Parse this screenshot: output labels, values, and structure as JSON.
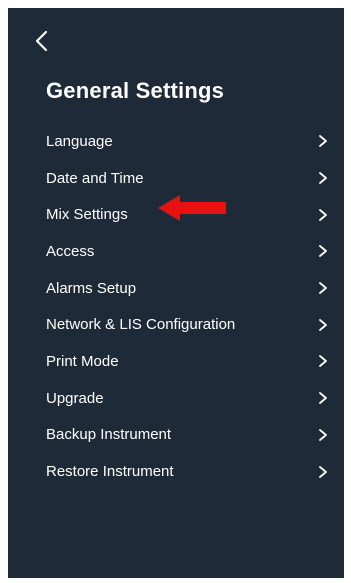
{
  "header": {
    "back_icon": "chevron-left-icon",
    "title": "General Settings"
  },
  "menu": {
    "items": [
      {
        "label": "Language"
      },
      {
        "label": "Date and Time"
      },
      {
        "label": "Mix Settings"
      },
      {
        "label": "Access"
      },
      {
        "label": "Alarms Setup"
      },
      {
        "label": "Network & LIS Configuration"
      },
      {
        "label": "Print Mode"
      },
      {
        "label": "Upgrade"
      },
      {
        "label": "Backup Instrument"
      },
      {
        "label": "Restore Instrument"
      }
    ],
    "chevron_icon": "chevron-right-icon"
  },
  "annotation": {
    "icon": "red-arrow-left-icon",
    "color": "#e8110f",
    "points_to": "Mix Settings"
  },
  "colors": {
    "background": "#1f2a38",
    "text": "#ffffff",
    "accent": "#e8110f"
  }
}
